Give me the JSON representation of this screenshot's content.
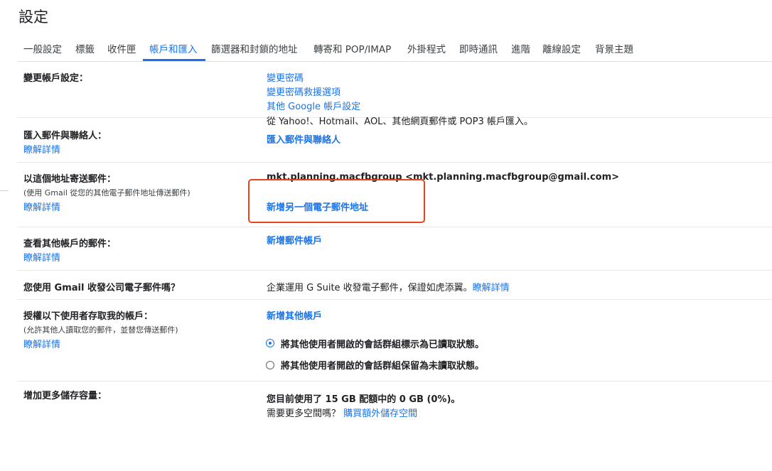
{
  "page_title": "設定",
  "tabs": [
    {
      "label": "一般設定"
    },
    {
      "label": "標籤"
    },
    {
      "label": "收件匣"
    },
    {
      "label": "帳戶和匯入",
      "active": true
    },
    {
      "label": "篩選器和封鎖的地址"
    },
    {
      "label": "轉寄和 POP/IMAP"
    },
    {
      "label": "外掛程式"
    },
    {
      "label": "即時通訊"
    },
    {
      "label": "進階"
    },
    {
      "label": "離線設定"
    },
    {
      "label": "背景主題"
    }
  ],
  "accent_color": "#1a73e8",
  "highlight_color": "#e8441c",
  "sections": {
    "change_account": {
      "label": "變更帳戶設定：",
      "links": [
        "變更密碼",
        "變更密碼救援選項",
        "其他 Google 帳戶設定"
      ]
    },
    "import": {
      "label": "匯入郵件與聯絡人：",
      "learn_more": "瞭解詳情",
      "description": "從 Yahoo!、Hotmail、AOL、其他網頁郵件或 POP3 帳戶匯入。",
      "action": "匯入郵件與聯絡人"
    },
    "send_as": {
      "label": "以這個地址寄送郵件：",
      "sub": "(使用 Gmail 從您的其他電子郵件地址傳送郵件)",
      "learn_more": "瞭解詳情",
      "address": "mkt.planning.macfbgroup <mkt.planning.macfbgroup@gmail.com>",
      "action": "新增另一個電子郵件地址"
    },
    "check_mail": {
      "label": "查看其他帳戶的郵件：",
      "learn_more": "瞭解詳情",
      "action": "新增郵件帳戶"
    },
    "work": {
      "label": "您使用 Gmail 收發公司電子郵件嗎？",
      "text": "企業運用 G Suite 收發電子郵件，保證如虎添翼。",
      "link": "瞭解詳情"
    },
    "grant": {
      "label": "授權以下使用者存取我的帳戶：",
      "sub": "(允許其他人讀取您的郵件，並替您傳送郵件)",
      "learn_more": "瞭解詳情",
      "action": "新增其他帳戶",
      "options": [
        {
          "label": "將其他使用者開啟的會話群組標示為已讀取狀態。",
          "selected": true
        },
        {
          "label": "將其他使用者開啟的會話群組保留為未讀取狀態。",
          "selected": false
        }
      ]
    },
    "storage": {
      "label": "增加更多儲存容量：",
      "usage": "您目前使用了 15 GB 配額中的 0 GB (0%)。",
      "question": "需要更多空間嗎？",
      "link": "購買額外儲存空間"
    }
  }
}
